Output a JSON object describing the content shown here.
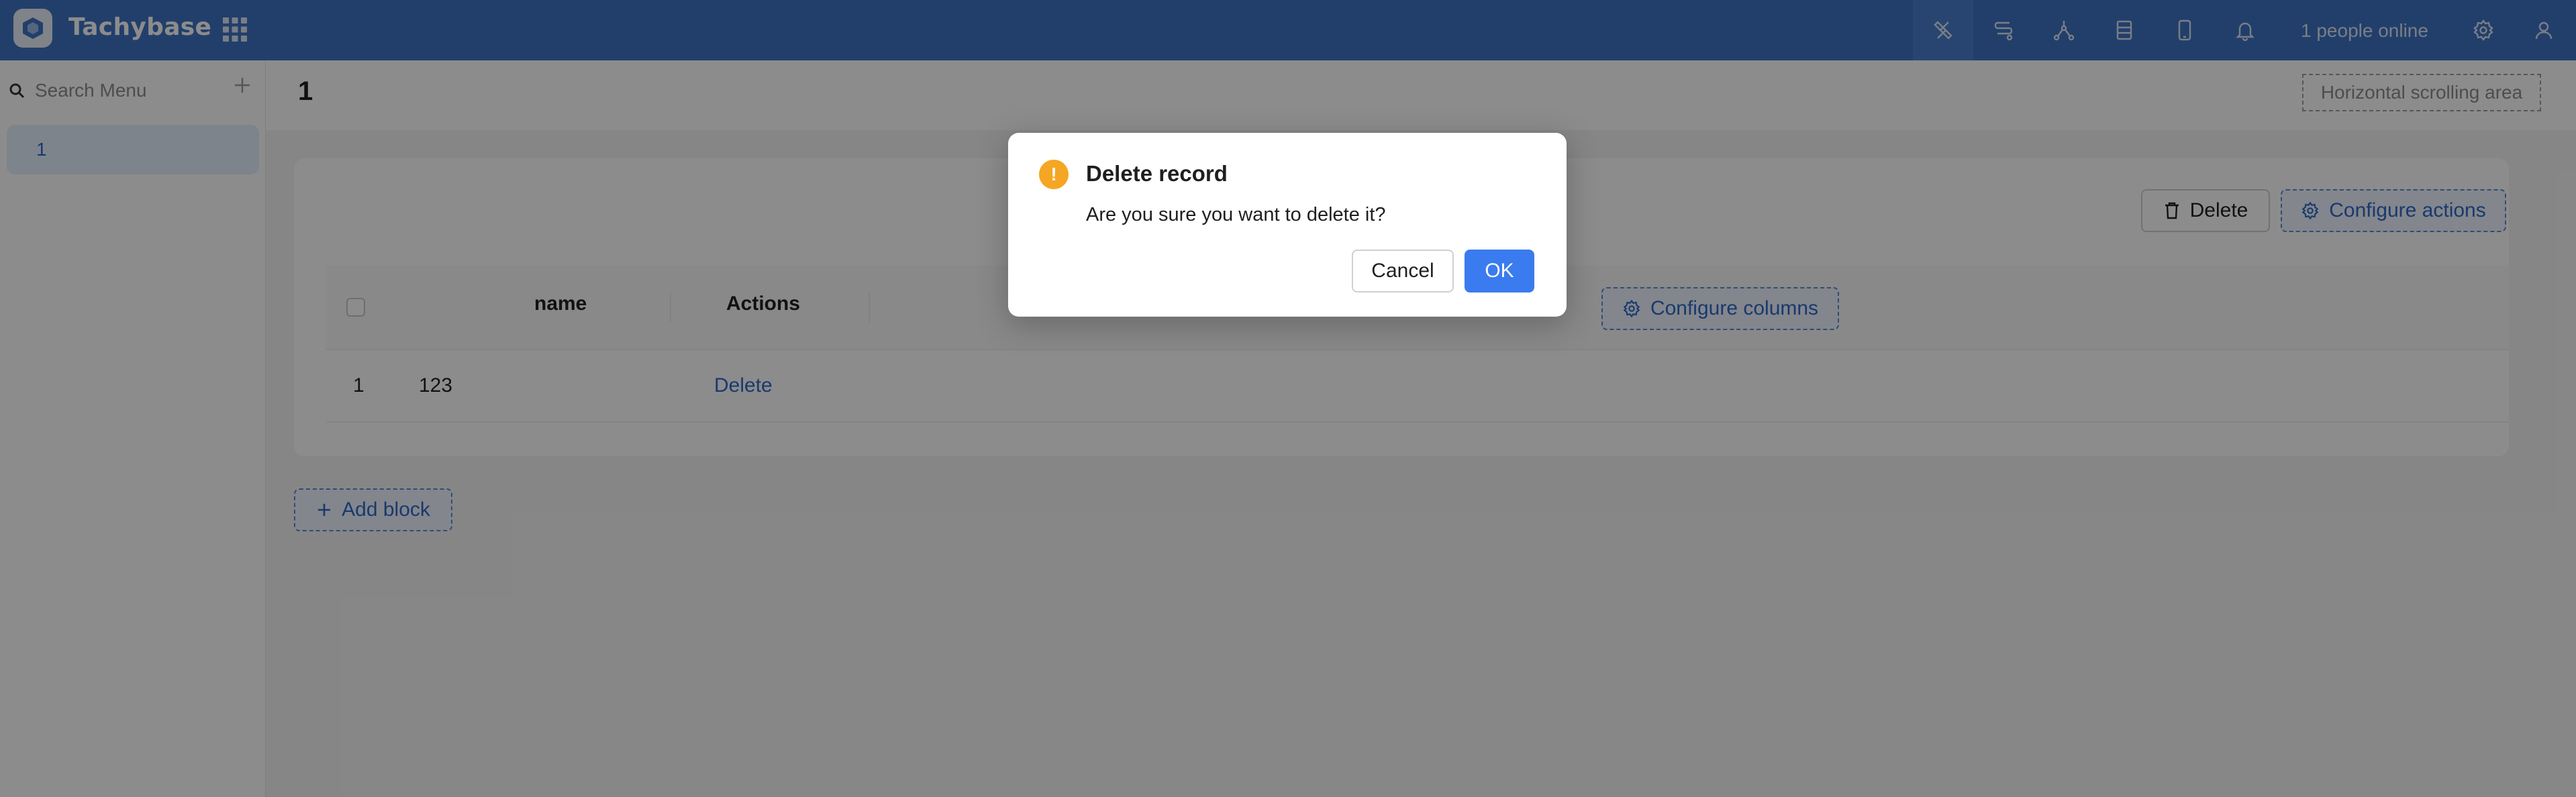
{
  "app": {
    "brand": "Tachybase"
  },
  "header": {
    "icons": [
      "plugin-icon",
      "workflow-icon",
      "graph-icon",
      "database-icon",
      "mobile-icon",
      "bell-icon"
    ],
    "online_text": "1 people online",
    "settings_icon": "gear-icon",
    "user_icon": "user-icon",
    "accent_color": "#3e73c4"
  },
  "sidebar": {
    "search_placeholder": "Search Menu",
    "items": [
      {
        "label": "1",
        "active": true
      }
    ]
  },
  "page": {
    "title": "1",
    "horizontal_scroll_label": "Horizontal scrolling area"
  },
  "table_block": {
    "actions": {
      "delete_label": "Delete",
      "configure_actions_label": "Configure actions"
    },
    "columns": [
      "name",
      "Actions"
    ],
    "configure_columns_label": "Configure columns",
    "rows": [
      {
        "index": "1",
        "name": "123",
        "action": "Delete"
      }
    ]
  },
  "add_block_label": "Add block",
  "modal": {
    "title": "Delete record",
    "content": "Are you sure you want to delete it?",
    "cancel_label": "Cancel",
    "ok_label": "OK",
    "warning_glyph": "!"
  }
}
